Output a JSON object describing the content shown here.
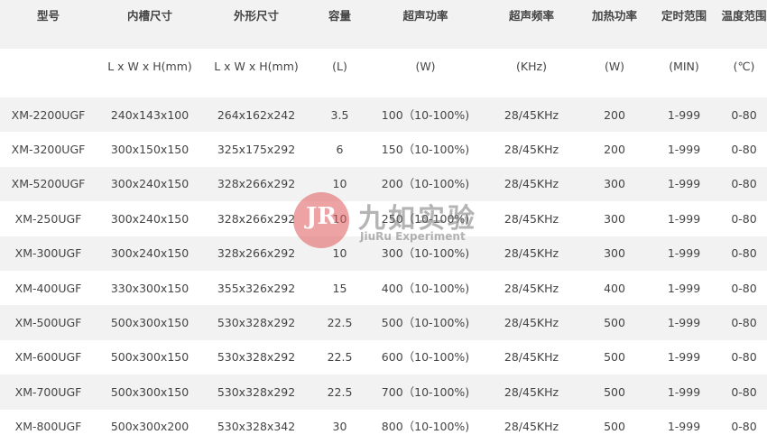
{
  "headers": [
    "型号",
    "内槽尺寸",
    "外形尺寸",
    "容量",
    "超声功率",
    "超声频率",
    "加热功率",
    "定时范围",
    "温度范围"
  ],
  "units": [
    "",
    "L x W x H(mm)",
    "L x W x H(mm)",
    "(L)",
    "(W)",
    "(KHz)",
    "(W)",
    "(MIN)",
    "(℃)"
  ],
  "rows": [
    [
      "XM-2200UGF",
      "240x143x100",
      "264x162x242",
      "3.5",
      "100（10-100%)",
      "28/45KHz",
      "200",
      "1-999",
      "0-80"
    ],
    [
      "XM-3200UGF",
      "300x150x150",
      "325x175x292",
      "6",
      "150（10-100%)",
      "28/45KHz",
      "200",
      "1-999",
      "0-80"
    ],
    [
      "XM-5200UGF",
      "300x240x150",
      "328x266x292",
      "10",
      "200（10-100%)",
      "28/45KHz",
      "300",
      "1-999",
      "0-80"
    ],
    [
      "XM-250UGF",
      "300x240x150",
      "328x266x292",
      "10",
      "250（10-100%)",
      "28/45KHz",
      "300",
      "1-999",
      "0-80"
    ],
    [
      "XM-300UGF",
      "300x240x150",
      "328x266x292",
      "10",
      "300（10-100%)",
      "28/45KHz",
      "300",
      "1-999",
      "0-80"
    ],
    [
      "XM-400UGF",
      "330x300x150",
      "355x326x292",
      "15",
      "400（10-100%)",
      "28/45KHz",
      "400",
      "1-999",
      "0-80"
    ],
    [
      "XM-500UGF",
      "500x300x150",
      "530x328x292",
      "22.5",
      "500（10-100%)",
      "28/45KHz",
      "500",
      "1-999",
      "0-80"
    ],
    [
      "XM-600UGF",
      "500x300x150",
      "530x328x292",
      "22.5",
      "600（10-100%)",
      "28/45KHz",
      "500",
      "1-999",
      "0-80"
    ],
    [
      "XM-700UGF",
      "500x300x150",
      "530x328x292",
      "22.5",
      "700（10-100%)",
      "28/45KHz",
      "500",
      "1-999",
      "0-80"
    ],
    [
      "XM-800UGF",
      "500x300x200",
      "530x328x342",
      "30",
      "800（10-100%)",
      "28/45KHz",
      "500",
      "1-999",
      "0-80"
    ]
  ],
  "watermark": {
    "logo_text": "JR",
    "cn": "九如实验",
    "en": "JiuRu Experiment",
    "color": "#e0585a"
  }
}
